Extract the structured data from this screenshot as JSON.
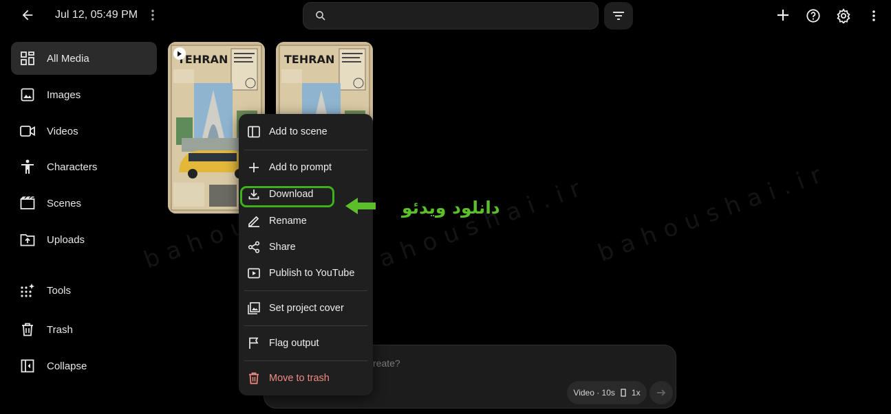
{
  "header": {
    "timestamp": "Jul 12, 05:49 PM",
    "search_placeholder": ""
  },
  "sidebar": {
    "items": [
      {
        "label": "All Media",
        "icon": "grid-icon",
        "active": true
      },
      {
        "label": "Images",
        "icon": "image-icon"
      },
      {
        "label": "Videos",
        "icon": "video-icon"
      },
      {
        "label": "Characters",
        "icon": "person-icon"
      },
      {
        "label": "Scenes",
        "icon": "clapper-icon"
      },
      {
        "label": "Uploads",
        "icon": "upload-icon"
      },
      {
        "label": "Tools",
        "icon": "sparkle-grid-icon"
      },
      {
        "label": "Trash",
        "icon": "trash-icon"
      },
      {
        "label": "Collapse",
        "icon": "collapse-icon"
      }
    ]
  },
  "media": {
    "thumbnails": [
      {
        "poster_title": "TEHRAN",
        "is_video": true
      },
      {
        "poster_title": "TEHRAN",
        "is_video": false
      }
    ]
  },
  "context_menu": {
    "items": [
      {
        "label": "Add to scene",
        "icon": "add-scene-icon"
      },
      {
        "label": "Add to prompt",
        "icon": "plus-icon"
      },
      {
        "label": "Download",
        "icon": "download-icon",
        "highlighted": true
      },
      {
        "label": "Rename",
        "icon": "pencil-icon"
      },
      {
        "label": "Share",
        "icon": "share-icon"
      },
      {
        "label": "Publish to YouTube",
        "icon": "youtube-icon"
      },
      {
        "label": "Set project cover",
        "icon": "cover-icon"
      },
      {
        "label": "Flag output",
        "icon": "flag-icon"
      },
      {
        "label": "Move to trash",
        "icon": "trash-icon",
        "danger": true
      }
    ]
  },
  "annotation": {
    "text": "دانلود ویدئو",
    "color": "#5cbf2a"
  },
  "watermark": "bahoushai.ir",
  "prompt": {
    "placeholder": "reate?",
    "mode_chip": "Video · 10s",
    "count": "1x"
  },
  "colors": {
    "background": "#000000",
    "panel": "#1f1f1f",
    "highlight": "#3db21b",
    "danger": "#f28b82"
  }
}
